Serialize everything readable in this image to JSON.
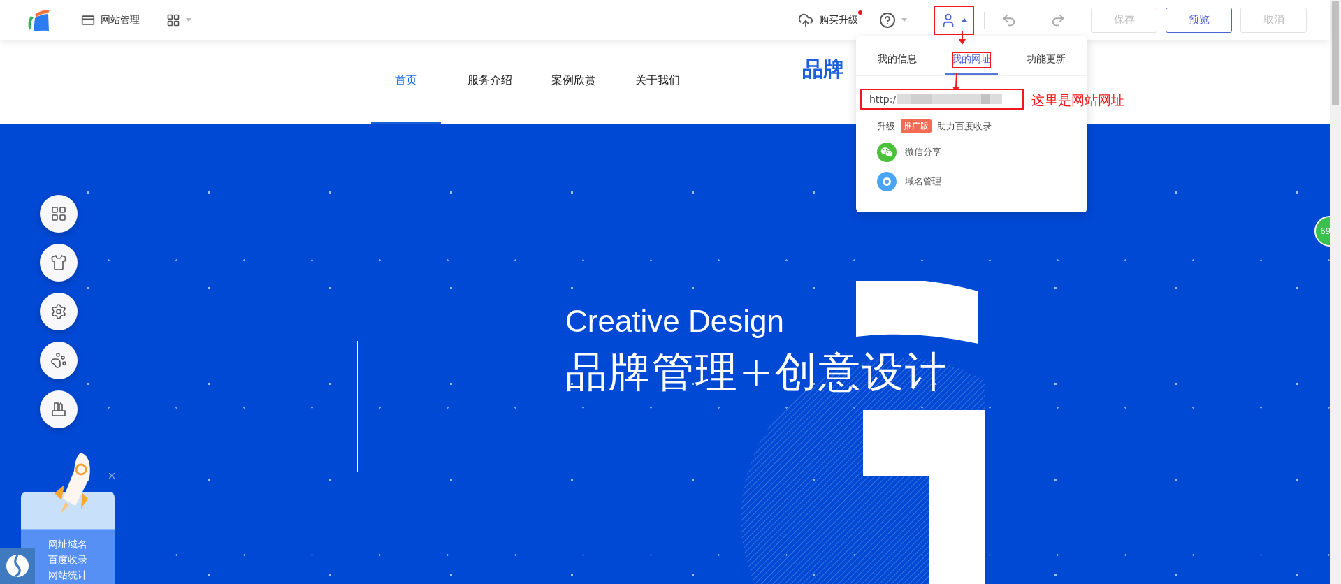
{
  "top_bar": {
    "site_manage": "网站管理",
    "upgrade": {
      "label": "购买升级",
      "notification": true
    },
    "account_annotated": true,
    "buttons": [
      {
        "label": "保存",
        "disabled": true
      },
      {
        "label": "预览",
        "disabled": false
      },
      {
        "label": "取消",
        "disabled": true
      }
    ]
  },
  "site_nav": {
    "items": [
      {
        "label": "首页",
        "selected": true
      },
      {
        "label": "服务介绍",
        "selected": false
      },
      {
        "label": "案例欣赏",
        "selected": false
      },
      {
        "label": "关于我们",
        "selected": false
      }
    ],
    "brand_title": "品牌"
  },
  "account_menu": {
    "tabs": [
      {
        "label": "我的信息",
        "selected": false,
        "annotated": false
      },
      {
        "label": "我的网址",
        "selected": true,
        "annotated": true
      },
      {
        "label": "功能更新",
        "selected": false,
        "annotated": false
      }
    ],
    "url_prefix": "http:/",
    "url_annotated": true,
    "upgrade_row": {
      "label": "升级",
      "badge": "推广版",
      "text": "助力百度收录"
    },
    "items": [
      {
        "kind": "wechat",
        "label": "微信分享"
      },
      {
        "kind": "domain",
        "label": "域名管理"
      }
    ]
  },
  "annotation": {
    "text": "这里是网站网址"
  },
  "hero": {
    "subtitle": "Creative Design",
    "title": "品牌管理+创意设计"
  },
  "tool_buttons": [
    {
      "kind": "apps"
    },
    {
      "kind": "shirt"
    },
    {
      "kind": "gear"
    },
    {
      "kind": "paw"
    },
    {
      "kind": "holder"
    }
  ],
  "promo": {
    "lines": [
      "网址域名",
      "百度收录",
      "网站统计"
    ]
  },
  "edge_badge": "69"
}
